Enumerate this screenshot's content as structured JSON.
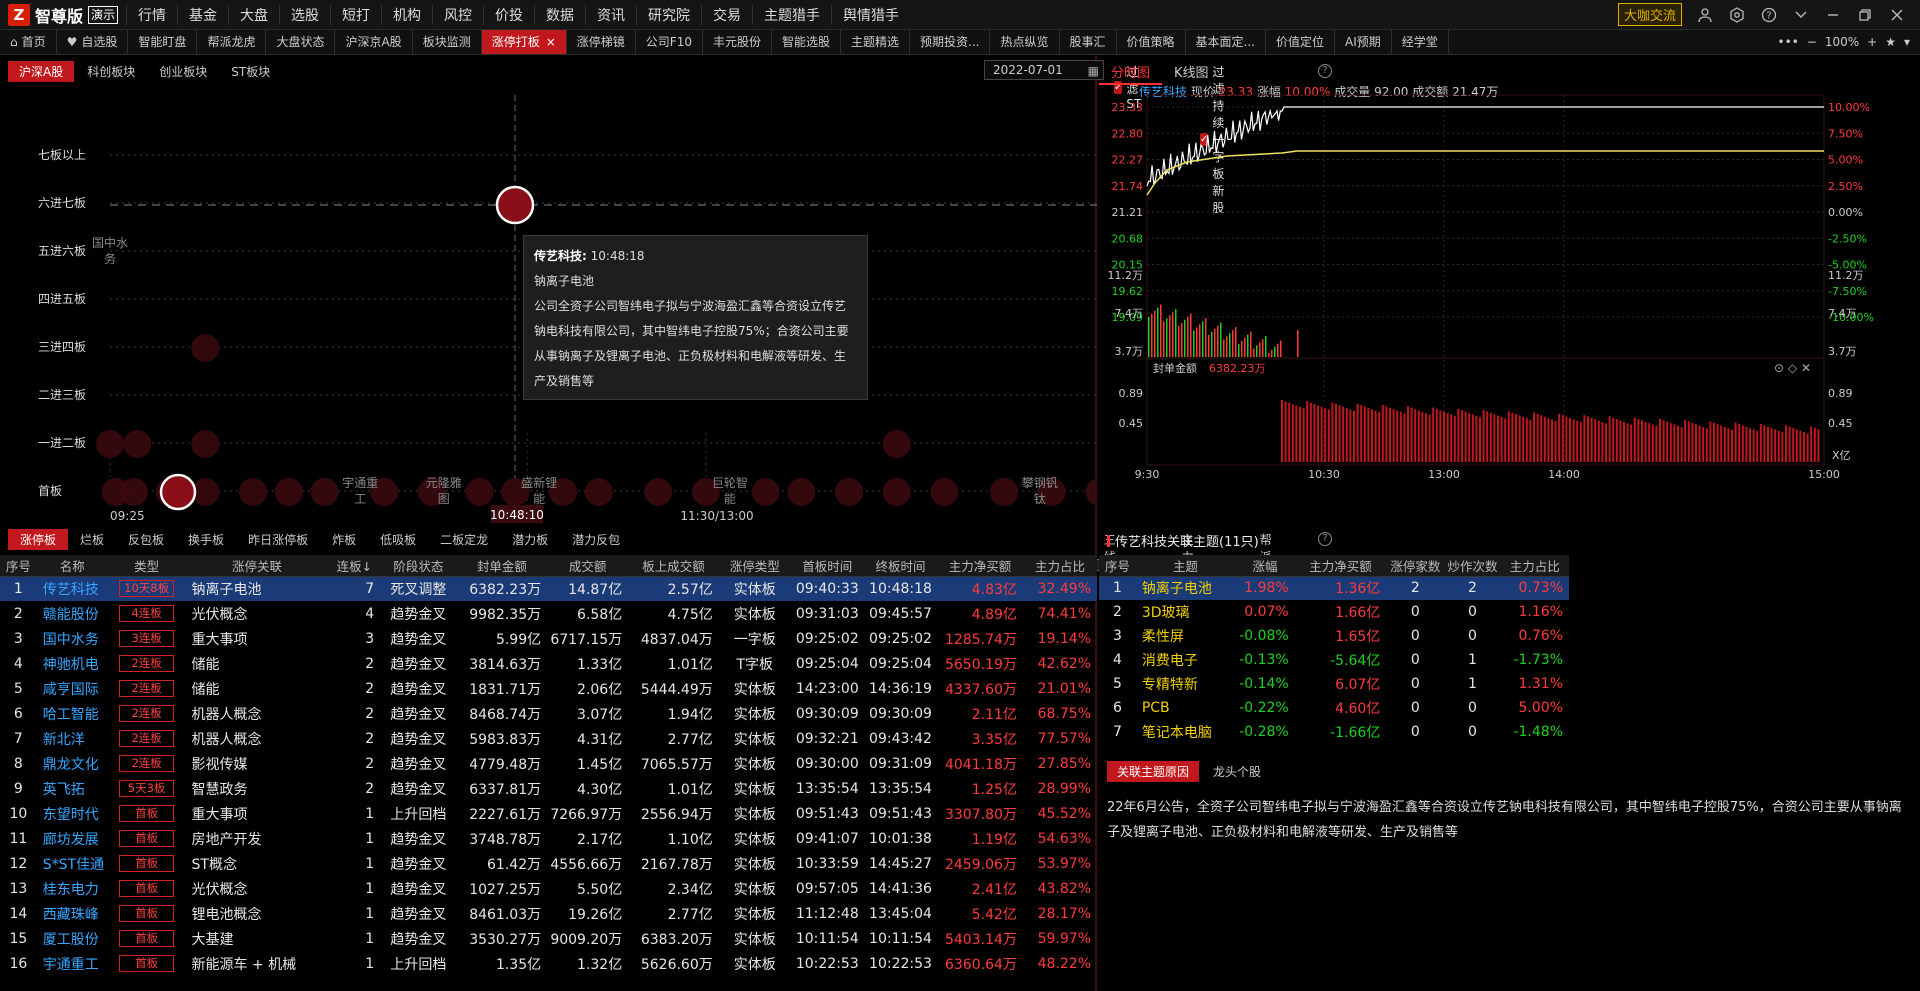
{
  "app": {
    "logo_char": "Z",
    "name": "智尊版",
    "demo": "演示",
    "exchange_button": "大咖交流"
  },
  "main_menu": [
    "行情",
    "基金",
    "大盘",
    "选股",
    "短打",
    "机构",
    "风控",
    "价投",
    "数据",
    "资讯",
    "研究院",
    "交易",
    "主题猎手",
    "舆情猎手"
  ],
  "main_menu_dots": [
    false,
    false,
    false,
    true,
    false,
    true,
    false,
    false,
    false,
    false,
    false,
    false,
    false,
    false
  ],
  "tabs": [
    "首页",
    "自选股",
    "智能盯盘",
    "帮派龙虎",
    "大盘状态",
    "沪深京A股",
    "板块监测",
    "涨停打板",
    "涨停梯镜",
    "公司F10",
    "丰元股份",
    "智能选股",
    "主题精选",
    "预期投资...",
    "热点纵览",
    "股事汇",
    "价值策略",
    "基本面定...",
    "价值定位",
    "AI预期",
    "经学堂"
  ],
  "active_tab": "涨停打板",
  "zoom": "100%",
  "ladder": {
    "subtabs": [
      "沪深A股",
      "科创板块",
      "创业板块",
      "ST板块"
    ],
    "date": "2022-07-01",
    "filter_st": "过滤ST",
    "filter_new": "过滤持续一字板新股",
    "levels": [
      "七板以上",
      "六进七板",
      "五进六板",
      "四进五板",
      "三进四板",
      "二进三板",
      "一进二板",
      "首板"
    ],
    "time_start": "09:25",
    "time_cursor": "10:48:10",
    "time_mid": "11:30/13:00",
    "time_end": "15:00",
    "bubble_labels": [
      {
        "text": "国中水务",
        "t": 0.0,
        "level": 5
      },
      {
        "text": "宇通重工",
        "t": 0.21,
        "level": 0
      },
      {
        "text": "元隆雅图",
        "t": 0.28,
        "level": 0
      },
      {
        "text": "盛新锂能",
        "t": 0.36,
        "level": 0
      },
      {
        "text": "巨轮智能",
        "t": 0.52,
        "level": 0
      },
      {
        "text": "攀钢钒钛",
        "t": 0.78,
        "level": 0
      }
    ]
  },
  "tooltip": {
    "name": "传艺科技:",
    "time": "10:48:18",
    "theme": "钠离子电池",
    "desc": "公司全资子公司智纬电子拟与宁波海盈汇鑫等合资设立传艺钠电科技有限公司，其中智纬电子控股75%；合资公司主要从事钠离子及锂离子电池、正负极材料和电解液等研发、生产及销售等"
  },
  "chart": {
    "tabs": [
      "分时图",
      "K线图"
    ],
    "stock": "传艺科技",
    "price_label": "现价",
    "price": "23.33",
    "change_label": "涨幅",
    "change": "10.00%",
    "volume_label": "成交量",
    "volume": "92.00",
    "amount_label": "成交额",
    "amount": "21.47万",
    "price_ticks": [
      "23.33",
      "22.80",
      "22.27",
      "21.74",
      "21.21",
      "20.68",
      "20.15",
      "19.62",
      "19.09"
    ],
    "pct_ticks": [
      "10.00%",
      "7.50%",
      "5.00%",
      "2.50%",
      "0.00%",
      "-2.50%",
      "-5.00%",
      "-7.50%",
      "-10.00%"
    ],
    "vol_ticks": [
      "11.2万",
      "7.4万",
      "3.7万"
    ],
    "seal_label": "封单金额",
    "seal_value": "6382.23万",
    "seal_ticks": [
      "0.89",
      "0.45"
    ],
    "seal_unit": "X亿",
    "x_ticks": [
      "9:30",
      "10:30",
      "13:00",
      "14:00",
      "15:00"
    ]
  },
  "bottom_tabs": [
    "涨停板",
    "烂板",
    "反包板",
    "换手板",
    "昨日涨停板",
    "炸板",
    "低吸板",
    "二板定龙",
    "潜力板",
    "潜力反包"
  ],
  "bottom_checks": [
    "三线拉升",
    "主力拉升",
    "帮派博弈"
  ],
  "table": {
    "headers": [
      "序号",
      "名称",
      "类型",
      "涨停关联",
      "连板↓",
      "阶段状态",
      "封单金额",
      "成交额",
      "板上成交额",
      "涨停类型",
      "首板时间",
      "终板时间",
      "主力净买额",
      "主力占比"
    ],
    "rows": [
      [
        "1",
        "传艺科技",
        "10天8板",
        "钠离子电池",
        "7",
        "死叉调整",
        "6382.23万",
        "14.87亿",
        "2.57亿",
        "实体板",
        "09:40:33",
        "10:48:18",
        "4.83亿",
        "32.49%"
      ],
      [
        "2",
        "赣能股份",
        "4连板",
        "光伏概念",
        "4",
        "趋势金叉",
        "9982.35万",
        "6.58亿",
        "4.75亿",
        "实体板",
        "09:31:03",
        "09:45:57",
        "4.89亿",
        "74.41%"
      ],
      [
        "3",
        "国中水务",
        "3连板",
        "重大事项",
        "3",
        "趋势金叉",
        "5.99亿",
        "6717.15万",
        "4837.04万",
        "一字板",
        "09:25:02",
        "09:25:02",
        "1285.74万",
        "19.14%"
      ],
      [
        "4",
        "神驰机电",
        "2连板",
        "储能",
        "2",
        "趋势金叉",
        "3814.63万",
        "1.33亿",
        "1.01亿",
        "T字板",
        "09:25:04",
        "09:25:04",
        "5650.19万",
        "42.62%"
      ],
      [
        "5",
        "咸亨国际",
        "2连板",
        "储能",
        "2",
        "趋势金叉",
        "1831.71万",
        "2.06亿",
        "5444.49万",
        "实体板",
        "14:23:00",
        "14:36:19",
        "4337.60万",
        "21.01%"
      ],
      [
        "6",
        "哈工智能",
        "2连板",
        "机器人概念",
        "2",
        "趋势金叉",
        "8468.74万",
        "3.07亿",
        "1.94亿",
        "实体板",
        "09:30:09",
        "09:30:09",
        "2.11亿",
        "68.75%"
      ],
      [
        "7",
        "新北洋",
        "2连板",
        "机器人概念",
        "2",
        "趋势金叉",
        "5983.83万",
        "4.31亿",
        "2.77亿",
        "实体板",
        "09:32:21",
        "09:43:42",
        "3.35亿",
        "77.57%"
      ],
      [
        "8",
        "鼎龙文化",
        "2连板",
        "影视传媒",
        "2",
        "趋势金叉",
        "4779.48万",
        "1.45亿",
        "7065.57万",
        "实体板",
        "09:30:00",
        "09:31:09",
        "4041.18万",
        "27.85%"
      ],
      [
        "9",
        "英飞拓",
        "5天3板",
        "智慧政务",
        "2",
        "趋势金叉",
        "6337.81万",
        "4.30亿",
        "1.01亿",
        "实体板",
        "13:35:54",
        "13:35:54",
        "1.25亿",
        "28.99%"
      ],
      [
        "10",
        "东望时代",
        "首板",
        "重大事项",
        "1",
        "上升回档",
        "2227.61万",
        "7266.97万",
        "2556.94万",
        "实体板",
        "09:51:43",
        "09:51:43",
        "3307.80万",
        "45.52%"
      ],
      [
        "11",
        "廊坊发展",
        "首板",
        "房地产开发",
        "1",
        "趋势金叉",
        "3748.78万",
        "2.17亿",
        "1.10亿",
        "实体板",
        "09:41:07",
        "10:01:38",
        "1.19亿",
        "54.63%"
      ],
      [
        "12",
        "S*ST佳通",
        "首板",
        "ST概念",
        "1",
        "趋势金叉",
        "61.42万",
        "4556.66万",
        "2167.78万",
        "实体板",
        "10:33:59",
        "14:45:27",
        "2459.06万",
        "53.97%"
      ],
      [
        "13",
        "桂东电力",
        "首板",
        "光伏概念",
        "1",
        "趋势金叉",
        "1027.25万",
        "5.50亿",
        "2.34亿",
        "实体板",
        "09:57:05",
        "14:41:36",
        "2.41亿",
        "43.82%"
      ],
      [
        "14",
        "西藏珠峰",
        "首板",
        "锂电池概念",
        "1",
        "趋势金叉",
        "8461.03万",
        "19.26亿",
        "2.77亿",
        "实体板",
        "11:12:48",
        "13:45:04",
        "5.42亿",
        "28.17%"
      ],
      [
        "15",
        "厦工股份",
        "首板",
        "大基建",
        "1",
        "趋势金叉",
        "3530.27万",
        "9009.20万",
        "6383.20万",
        "实体板",
        "10:11:54",
        "10:11:54",
        "5403.14万",
        "59.97%"
      ],
      [
        "16",
        "宇通重工",
        "首板",
        "新能源车 + 机械",
        "1",
        "上升回档",
        "1.35亿",
        "1.32亿",
        "5626.60万",
        "实体板",
        "10:22:53",
        "10:22:53",
        "6360.64万",
        "48.22%"
      ]
    ]
  },
  "themes": {
    "title": "传艺科技关联主题(11只)",
    "headers": [
      "序号",
      "主题",
      "涨幅",
      "主力净买额",
      "涨停家数",
      "炒作次数",
      "主力占比"
    ],
    "rows": [
      [
        "1",
        "钠离子电池",
        "1.98%",
        "1.36亿",
        "2",
        "2",
        "0.73%"
      ],
      [
        "2",
        "3D玻璃",
        "0.07%",
        "1.66亿",
        "0",
        "0",
        "1.16%"
      ],
      [
        "3",
        "柔性屏",
        "-0.08%",
        "1.65亿",
        "0",
        "0",
        "0.76%"
      ],
      [
        "4",
        "消费电子",
        "-0.13%",
        "-5.64亿",
        "0",
        "1",
        "-1.73%"
      ],
      [
        "5",
        "专精特新",
        "-0.14%",
        "6.07亿",
        "0",
        "1",
        "1.31%"
      ],
      [
        "6",
        "PCB",
        "-0.22%",
        "4.60亿",
        "0",
        "0",
        "5.00%"
      ],
      [
        "7",
        "笔记本电脑",
        "-0.28%",
        "-1.66亿",
        "0",
        "0",
        "-1.48%"
      ]
    ],
    "reason_tabs": [
      "关联主题原因",
      "龙头个股"
    ],
    "reason_text": "22年6月公告，全资子公司智纬电子拟与宁波海盈汇鑫等合资设立传艺钠电科技有限公司，其中智纬电子控股75%，合资公司主要从事钠离子及锂离子电池、正负极材料和电解液等研发、生产及销售等"
  },
  "colors": {
    "accent": "#c0181c",
    "up": "#ff3b3b",
    "down": "#1fd11f",
    "name": "#36a6ff",
    "theme": "#f0d000"
  }
}
